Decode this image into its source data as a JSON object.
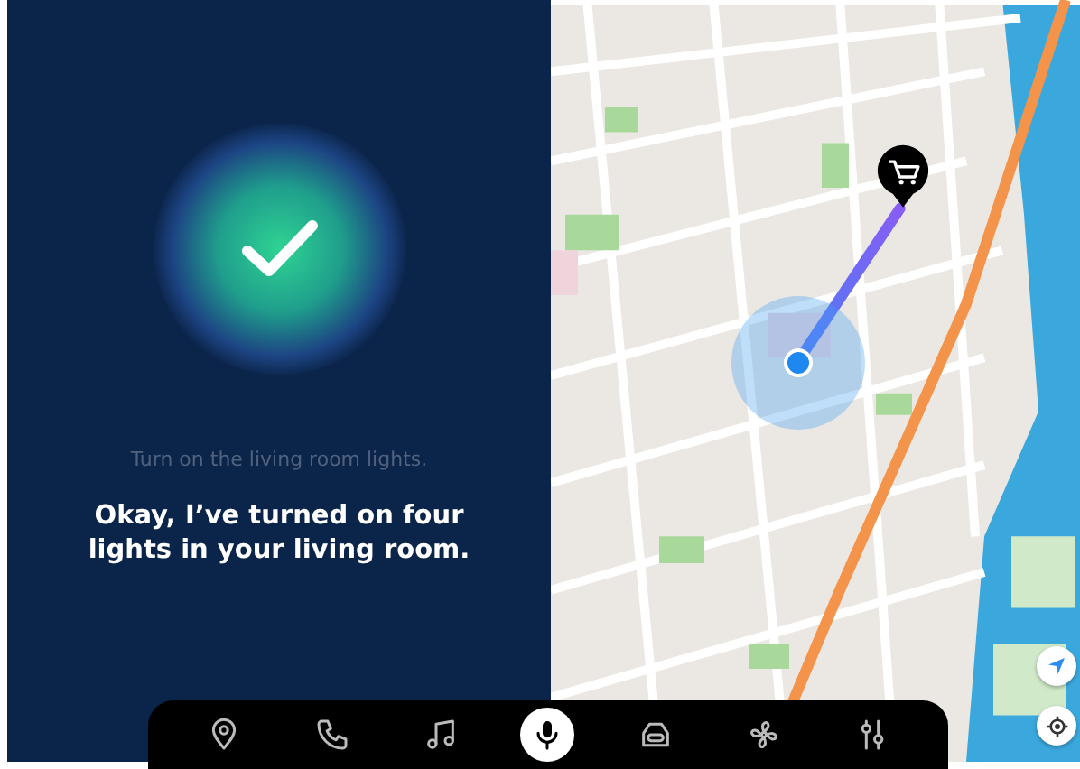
{
  "assistant": {
    "request": "Turn on the living room lights.",
    "response": "Okay, I’ve turned on four lights in your living room."
  },
  "dock": {
    "items": [
      {
        "selected": false
      },
      {
        "selected": false
      },
      {
        "selected": false
      },
      {
        "selected": true
      },
      {
        "selected": false
      },
      {
        "selected": false
      },
      {
        "selected": false
      }
    ]
  }
}
